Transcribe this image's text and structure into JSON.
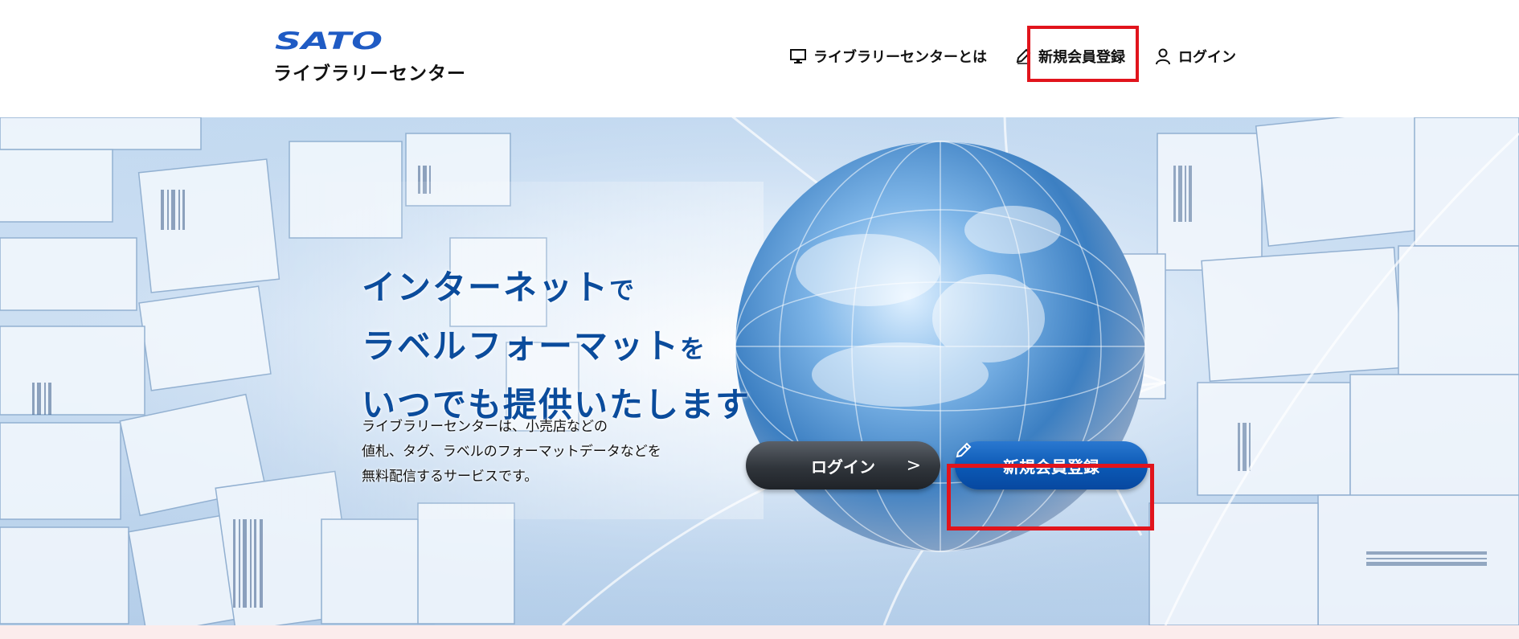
{
  "brand": {
    "logo_text": "SATO",
    "subtitle": "ライブラリーセンター",
    "logo_color": "#1f5bc4"
  },
  "nav": {
    "about": {
      "label": "ライブラリーセンターとは",
      "icon": "monitor-icon"
    },
    "register": {
      "label": "新規会員登録",
      "icon": "pencil-icon"
    },
    "login": {
      "label": "ログイン",
      "icon": "user-icon"
    }
  },
  "hero": {
    "headline": {
      "line1_big": "インターネット",
      "line1_small": "で",
      "line2_big": "ラベルフォーマット",
      "line2_small": "を",
      "line3": "いつでも提供いたします"
    },
    "description": [
      "ライブラリーセンターは、小売店などの",
      "値札、タグ、ラベルのフォーマットデータなどを",
      "無料配信するサービスです。"
    ],
    "login_button": "ログイン",
    "login_chevron": ">",
    "register_button": "新規会員登録"
  },
  "colors": {
    "headline": "#0b4c9c",
    "highlight": "#e1141c",
    "register_button": "#0b58b4",
    "login_button": "#30353b"
  }
}
